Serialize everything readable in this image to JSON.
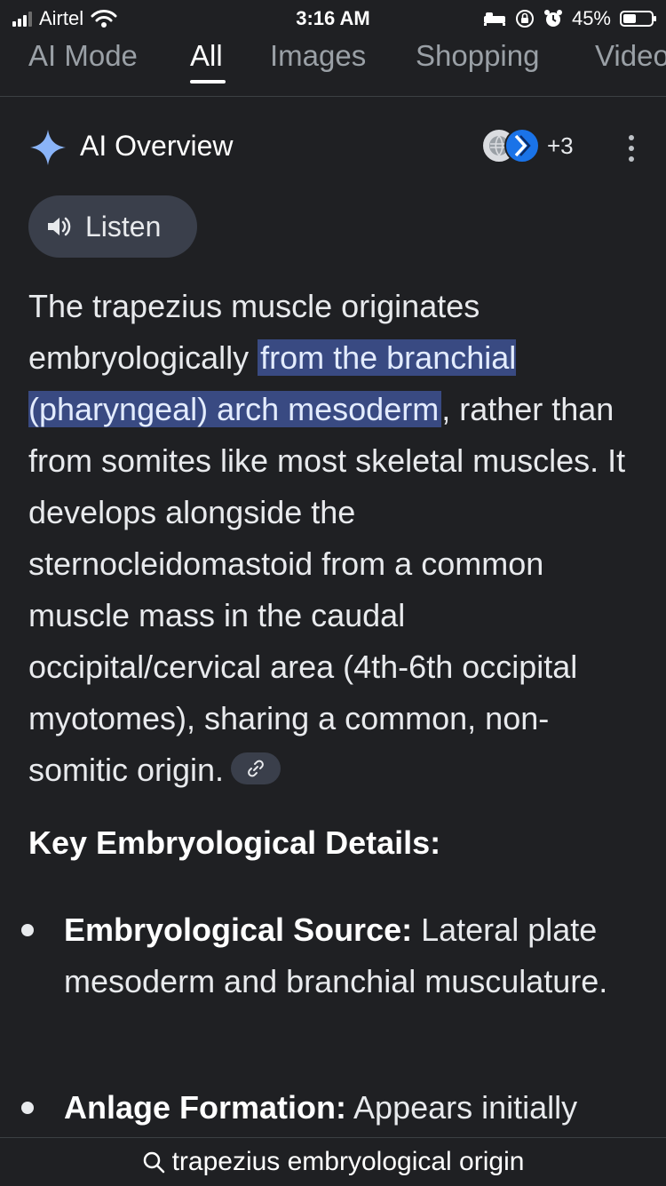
{
  "status_bar": {
    "carrier": "Airtel",
    "time": "3:16 AM",
    "battery_percent": "45%",
    "battery_level": 0.45
  },
  "tabs": [
    "AI Mode",
    "All",
    "Images",
    "Shopping",
    "Videos"
  ],
  "active_tab": "All",
  "ai_overview": {
    "title": "AI Overview",
    "sources_count": "+3",
    "listen_label": "Listen",
    "text_before": "The trapezius muscle originates embryologically ",
    "text_highlight": "from the branchial (pharyngeal) arch mesoderm",
    "text_after": ", rather than from somites like most skeletal muscles. It develops alongside the sternocleidomastoid from a common muscle mass in the caudal occipital/cervical area (4th-6th occipital myotomes), sharing a common, non-somitic origin."
  },
  "section": {
    "heading": "Key Embryological Details:",
    "bullets": [
      {
        "label": "Embryological Source:",
        "text": " Lateral plate mesoderm and branchial musculature."
      },
      {
        "label": "Anlage Formation:",
        "text": " Appears initially"
      }
    ]
  },
  "bottom_search": {
    "query": "trapezius embryological origin"
  },
  "colors": {
    "background": "#1f2023",
    "highlight": "#394a82",
    "chip": "#3a3f4b",
    "sparkle": "#8ab4f8"
  }
}
